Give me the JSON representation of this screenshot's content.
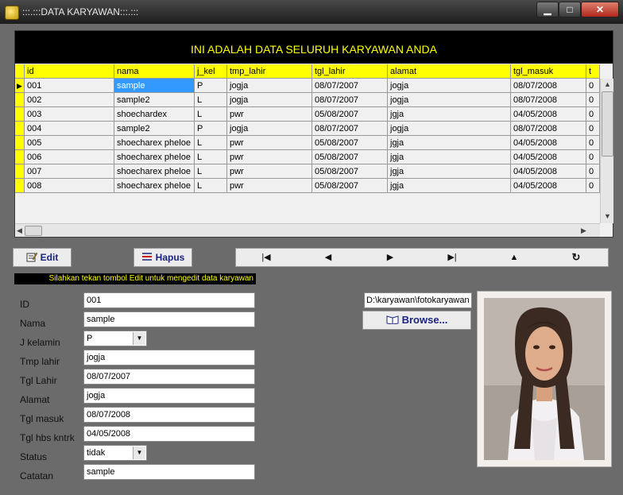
{
  "window": {
    "title": ":::.:::DATA KARYAWAN:::.:::",
    "min_label": "▁",
    "max_label": "□",
    "close_label": "✕"
  },
  "grid": {
    "caption": "INI ADALAH DATA SELURUH KARYAWAN ANDA",
    "columns": [
      "id",
      "nama",
      "j_kel",
      "tmp_lahir",
      "tgl_lahir",
      "alamat",
      "tgl_masuk",
      "t"
    ],
    "rows": [
      [
        "001",
        "sample",
        "P",
        "jogja",
        "08/07/2007",
        "jogja",
        "08/07/2008",
        "0"
      ],
      [
        "002",
        "sample2",
        "L",
        "jogja",
        "08/07/2007",
        "jogja",
        "08/07/2008",
        "0"
      ],
      [
        "003",
        "shoechardex",
        "L",
        "pwr",
        "05/08/2007",
        "jgja",
        "04/05/2008",
        "0"
      ],
      [
        "004",
        "sample2",
        "P",
        "jogja",
        "08/07/2007",
        "jogja",
        "08/07/2008",
        "0"
      ],
      [
        "005",
        "shoecharex pheloe",
        "L",
        "pwr",
        "05/08/2007",
        "jgja",
        "04/05/2008",
        "0"
      ],
      [
        "006",
        "shoecharex pheloe",
        "L",
        "pwr",
        "05/08/2007",
        "jgja",
        "04/05/2008",
        "0"
      ],
      [
        "007",
        "shoecharex pheloe",
        "L",
        "pwr",
        "05/08/2007",
        "jgja",
        "04/05/2008",
        "0"
      ],
      [
        "008",
        "shoecharex pheloe",
        "L",
        "pwr",
        "05/08/2007",
        "jgja",
        "04/05/2008",
        "0"
      ]
    ],
    "current_row_marker": "▶",
    "scroll_up": "▲",
    "scroll_down": "▼",
    "scroll_left": "◀",
    "scroll_right": "▶"
  },
  "toolbar": {
    "edit_label": "Edit",
    "hapus_label": "Hapus",
    "edit_icon": "edit-icon",
    "hapus_icon": "delete-icon"
  },
  "navigator": {
    "first": "|◀",
    "prev": "◀",
    "next": "▶",
    "last": "▶|",
    "up": "▲",
    "refresh": "↻"
  },
  "hint": "Silahkan tekan tombol Edit untuk mengedit data karyawan",
  "form": {
    "id_label": "ID",
    "id_value": "001",
    "nama_label": "Nama",
    "nama_value": "sample",
    "jkel_label": "J kelamin",
    "jkel_value": "P",
    "tmp_label": "Tmp lahir",
    "tmp_value": "jogja",
    "tgl_lahir_label": "Tgl Lahir",
    "tgl_lahir_value": "08/07/2007",
    "alamat_label": "Alamat",
    "alamat_value": "jogja",
    "tgl_masuk_label": "Tgl masuk",
    "tgl_masuk_value": "08/07/2008",
    "tgl_hbs_label": "Tgl hbs kntrk",
    "tgl_hbs_value": "04/05/2008",
    "status_label": "Status",
    "status_value": "tidak",
    "catatan_label": "Catatan",
    "catatan_value": "sample",
    "dropdown_arrow": "▼"
  },
  "photo": {
    "path": "D:\\karyawan\\fotokaryawan",
    "browse_label": "Browse..."
  },
  "colors": {
    "accent": "#ffff00",
    "selection": "#3399ff",
    "background": "#6b6b6b"
  }
}
